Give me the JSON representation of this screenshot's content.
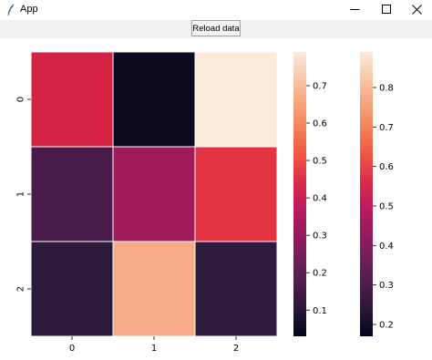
{
  "window": {
    "title": "App",
    "icon": "feather-icon",
    "controls": [
      "minimize-icon",
      "maximize-icon",
      "close-icon"
    ]
  },
  "toolbar": {
    "reload_label": "Reload data"
  },
  "chart_data": {
    "type": "heatmap",
    "rows": [
      "0",
      "1",
      "2"
    ],
    "columns": [
      "0",
      "1",
      "2"
    ],
    "values": [
      [
        0.52,
        0.03,
        0.76
      ],
      [
        0.29,
        0.42,
        0.55
      ],
      [
        0.21,
        0.65,
        0.22
      ]
    ],
    "cell_colors": [
      [
        "#d42245",
        "#0d0a1f",
        "#fbebda"
      ],
      [
        "#4a1c4b",
        "#a11a5b",
        "#e13342"
      ],
      [
        "#2c1a3a",
        "#f5ab87",
        "#2e1b3d"
      ]
    ],
    "gridlines": "white",
    "colorbars": [
      {
        "range": [
          0.03,
          0.79
        ],
        "ticks": [
          "0.1",
          "0.2",
          "0.3",
          "0.4",
          "0.5",
          "0.6",
          "0.7"
        ],
        "tick_values": [
          0.1,
          0.2,
          0.3,
          0.4,
          0.5,
          0.6,
          0.7
        ]
      },
      {
        "range": [
          0.17,
          0.89
        ],
        "ticks": [
          "0.2",
          "0.3",
          "0.4",
          "0.5",
          "0.6",
          "0.7",
          "0.8"
        ],
        "tick_values": [
          0.2,
          0.3,
          0.4,
          0.5,
          0.6,
          0.7,
          0.8
        ]
      }
    ],
    "colormap": [
      "#03051a",
      "#2a1636",
      "#4c1d4b",
      "#701f57",
      "#961b5e",
      "#bb1b5e",
      "#dd2c4b",
      "#ef5543",
      "#f47f55",
      "#f6a47c",
      "#f8c8a9",
      "#faebdd"
    ]
  }
}
